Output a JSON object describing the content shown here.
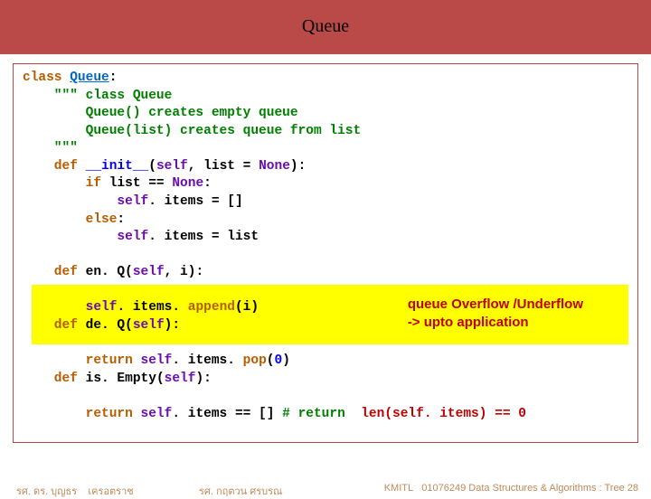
{
  "header": {
    "title": "Queue"
  },
  "code": {
    "l1_kw": "class ",
    "l1_cls": "Queue",
    "l1_colon": ":",
    "l2": "    \"\"\" class Queue",
    "l3": "        Queue() creates empty queue",
    "l4": "        Queue(list) creates queue from list",
    "l5": "    \"\"\"",
    "l6_def": "    def ",
    "l6_name": "__init__",
    "l6_open": "(",
    "l6_self": "self",
    "l6_rest": ", list = ",
    "l6_none": "None",
    "l6_close": "):",
    "l7_if": "        if ",
    "l7_cond": "list == ",
    "l7_none": "None",
    "l7_colon": ":",
    "l8_pre": "            ",
    "l8_self": "self",
    "l8_rest": ". items = []",
    "l9": "        else",
    "l9_colon": ":",
    "l10_pre": "            ",
    "l10_self": "self",
    "l10_rest": ". items = list",
    "l12_def": "    def ",
    "l12_name": "en. Q",
    "l12_open": "(",
    "l12_self": "self",
    "l12_rest": ", i):",
    "l14_pre": "        ",
    "l14_self": "self",
    "l14_items": ". items. ",
    "l14_append": "append",
    "l14_arg": "(i)",
    "l15_def": "    def ",
    "l15_name": "de. Q",
    "l15_open": "(",
    "l15_self": "self",
    "l15_close": "):",
    "l17_pre": "        return ",
    "l17_self": "self",
    "l17_items": ". items. ",
    "l17_pop": "pop",
    "l17_open": "(",
    "l17_zero": "0",
    "l17_close": ")",
    "l18_def": "    def ",
    "l18_name": "is. Empty",
    "l18_open": "(",
    "l18_self": "self",
    "l18_close": "):",
    "l20_pre": "        return ",
    "l20_self": "self",
    "l20_mid": ". items == [] ",
    "l20_hash": "#",
    "l20_ret": " return  ",
    "l20_len": "len",
    "l20_open": "(",
    "l20_self2": "self",
    "l20_rest": ". items) == ",
    "l20_zero": "0"
  },
  "note": {
    "line1": "queue Overflow /Underflow",
    "line2": "-> upto application"
  },
  "footer": {
    "left_a": "รศ. ดร. บุญธร",
    "left_b": "เครอตราช",
    "mid": "รศ. กฤตวน   ศรบรณ",
    "right_inst": "KMITL",
    "right_course": "01076249 Data Structures & Algorithms : Tree 28"
  }
}
